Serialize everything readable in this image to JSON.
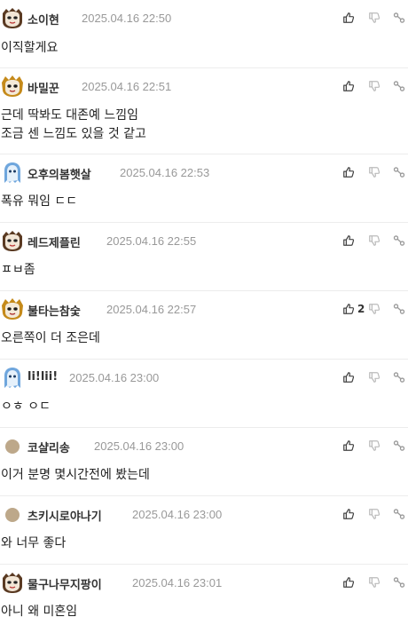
{
  "comments": [
    {
      "nick": "소이현",
      "date": "2025.04.16 22:50",
      "text": "이직할게요",
      "avatar": "mask-avatar",
      "likes": ""
    },
    {
      "nick": "바밀꾼",
      "date": "2025.04.16 22:51",
      "text": "근데 딱봐도 대존예 느낌임\n조금 센 느낌도 있을 것 같고",
      "avatar": "gold-mask-avatar",
      "likes": ""
    },
    {
      "nick": "오후의봄햇살",
      "date": "2025.04.16 22:53",
      "text": "폭유 뭐임 ㄷㄷ",
      "avatar": "ghost-avatar",
      "likes": ""
    },
    {
      "nick": "레드제플린",
      "date": "2025.04.16 22:55",
      "text": "ㅍㅂ좀",
      "avatar": "mask-avatar",
      "likes": ""
    },
    {
      "nick": "불타는참숯",
      "date": "2025.04.16 22:57",
      "text": "오른쪽이 더 조은데",
      "avatar": "gold-mask-avatar",
      "likes": "2"
    },
    {
      "nick": "li!lii!",
      "date": "2025.04.16 23:00",
      "text": "ㅇㅎ ㅇㄷ",
      "avatar": "ghost-avatar",
      "likes": ""
    },
    {
      "nick": "코샬리송",
      "date": "2025.04.16 23:00",
      "text": "이거 분명 몇시간전에 봤는데",
      "avatar": "circle-avatar",
      "likes": ""
    },
    {
      "nick": "츠키시로야나기",
      "date": "2025.04.16 23:00",
      "text": "와 너무 좋다",
      "avatar": "circle-avatar",
      "likes": ""
    },
    {
      "nick": "물구나무지팡이",
      "date": "2025.04.16 23:01",
      "text": "아니 왜 미혼임",
      "avatar": "mask-avatar",
      "likes": ""
    }
  ],
  "icons": {
    "like": "thumbs-up-icon",
    "dislike": "thumbs-down-icon",
    "share": "link-icon"
  },
  "colors": {
    "nick": "#333333",
    "date": "#999999",
    "icon": "#888888",
    "divider": "#ececec"
  }
}
